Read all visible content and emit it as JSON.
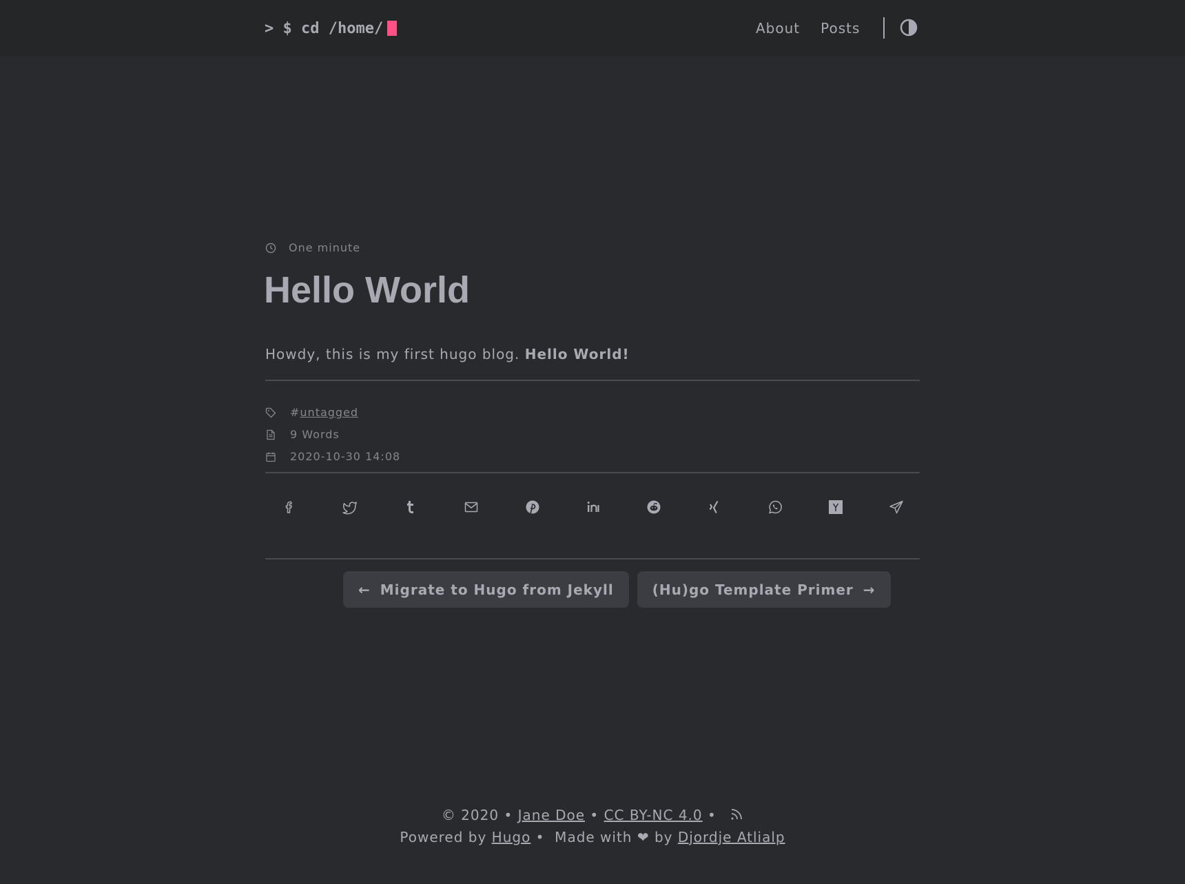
{
  "header": {
    "logo_text": "> $ cd /home/",
    "nav": [
      {
        "label": "About"
      },
      {
        "label": "Posts"
      }
    ],
    "theme_toggle_icon": "contrast-icon"
  },
  "post": {
    "reading_time": "One minute",
    "title": "Hello World",
    "body_plain": "Howdy, this is my first hugo blog. ",
    "body_bold": "Hello World!",
    "tag_prefix": "#",
    "tag": "untagged",
    "word_count": "9 Words",
    "date": "2020-10-30 14:08"
  },
  "share": [
    {
      "icon": "facebook-icon"
    },
    {
      "icon": "twitter-icon"
    },
    {
      "icon": "tumblr-icon"
    },
    {
      "icon": "email-icon"
    },
    {
      "icon": "pinterest-icon"
    },
    {
      "icon": "linkedin-icon"
    },
    {
      "icon": "reddit-icon"
    },
    {
      "icon": "xing-icon"
    },
    {
      "icon": "whatsapp-icon"
    },
    {
      "icon": "hackernews-icon"
    },
    {
      "icon": "telegram-icon"
    }
  ],
  "pager": {
    "prev_label": "Migrate to Hugo from Jekyll",
    "next_label": "(Hu)go Template Primer"
  },
  "footer": {
    "copyright": "© 2020 • ",
    "author": "Jane Doe",
    "sep1": " • ",
    "license": "CC BY-NC 4.0",
    "sep2": " • ",
    "powered_by": "Powered by ",
    "hugo": "Hugo",
    "made_with": " •  Made with ❤ by ",
    "theme_author": "Djordje Atlialp"
  },
  "colors": {
    "background": "#292a2d",
    "header": "#252627",
    "text": "#a9a9b3",
    "accent": "#fe5186"
  }
}
